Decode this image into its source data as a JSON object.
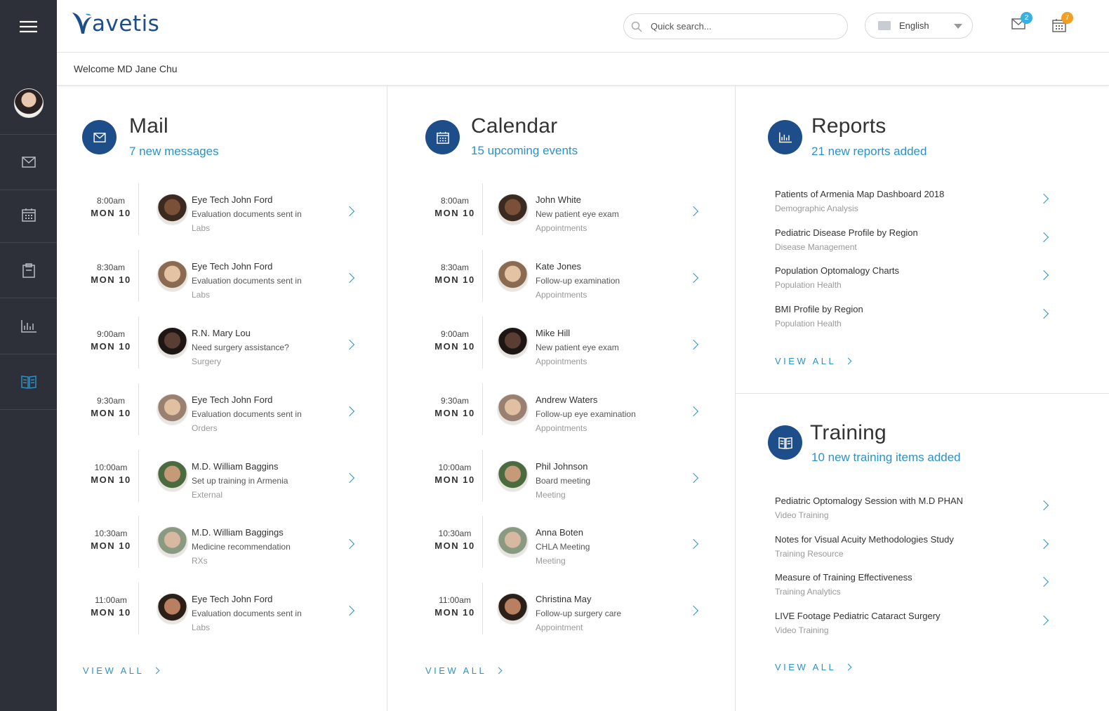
{
  "header": {
    "logo_text": "avetis",
    "search_placeholder": "Quick search...",
    "language": "English",
    "mail_badge": "2",
    "calendar_badge": "7",
    "mail_badge_color": "#3ab0e2",
    "calendar_badge_color": "#f0a024"
  },
  "welcome": "Welcome MD Jane Chu",
  "colors": {
    "accent": "#2a92c8",
    "brand": "#1d4e89",
    "sidebar": "#2d3038"
  },
  "mail": {
    "title": "Mail",
    "subtitle": "7 new messages",
    "view_all": "VIEW ALL",
    "items": [
      {
        "time": "8:00am",
        "day": "MON 10",
        "name": "Eye Tech John Ford",
        "desc": "Evaluation documents sent in",
        "cat": "Labs"
      },
      {
        "time": "8:30am",
        "day": "MON 10",
        "name": "Eye Tech John Ford",
        "desc": "Evaluation documents sent in",
        "cat": "Labs"
      },
      {
        "time": "9:00am",
        "day": "MON 10",
        "name": "R.N. Mary Lou",
        "desc": "Need surgery assistance?",
        "cat": "Surgery"
      },
      {
        "time": "9:30am",
        "day": "MON 10",
        "name": "Eye Tech John Ford",
        "desc": "Evaluation documents sent in",
        "cat": "Orders"
      },
      {
        "time": "10:00am",
        "day": "MON 10",
        "name": "M.D. William Baggins",
        "desc": "Set up training in Armenia",
        "cat": "External"
      },
      {
        "time": "10:30am",
        "day": "MON 10",
        "name": "M.D. William Baggings",
        "desc": "Medicine recommendation",
        "cat": "RXs"
      },
      {
        "time": "11:00am",
        "day": "MON 10",
        "name": "Eye Tech John Ford",
        "desc": "Evaluation documents sent in",
        "cat": "Labs"
      }
    ]
  },
  "calendar": {
    "title": "Calendar",
    "subtitle": "15 upcoming events",
    "view_all": "VIEW ALL",
    "items": [
      {
        "time": "8:00am",
        "day": "MON 10",
        "name": "John White",
        "desc": "New patient eye exam",
        "cat": "Appointments"
      },
      {
        "time": "8:30am",
        "day": "MON 10",
        "name": "Kate Jones",
        "desc": "Follow-up examination",
        "cat": "Appointments"
      },
      {
        "time": "9:00am",
        "day": "MON 10",
        "name": "Mike Hill",
        "desc": "New patient eye exam",
        "cat": "Appointments"
      },
      {
        "time": "9:30am",
        "day": "MON 10",
        "name": "Andrew Waters",
        "desc": "Follow-up eye examination",
        "cat": "Appointments"
      },
      {
        "time": "10:00am",
        "day": "MON 10",
        "name": "Phil Johnson",
        "desc": "Board meeting",
        "cat": "Meeting"
      },
      {
        "time": "10:30am",
        "day": "MON 10",
        "name": "Anna Boten",
        "desc": "CHLA Meeting",
        "cat": "Meeting"
      },
      {
        "time": "11:00am",
        "day": "MON 10",
        "name": "Christina May",
        "desc": "Follow-up surgery care",
        "cat": "Appointment"
      }
    ]
  },
  "reports": {
    "title": "Reports",
    "subtitle": "21 new reports added",
    "view_all": "VIEW ALL",
    "items": [
      {
        "title": "Patients of Armenia Map Dashboard 2018",
        "cat": "Demographic Analysis"
      },
      {
        "title": "Pediatric Disease Profile by Region",
        "cat": "Disease Management"
      },
      {
        "title": "Population Optomalogy Charts",
        "cat": "Population Health"
      },
      {
        "title": "BMI Profile by Region",
        "cat": "Population Health"
      }
    ]
  },
  "training": {
    "title": "Training",
    "subtitle": "10 new training items added",
    "view_all": "VIEW ALL",
    "items": [
      {
        "title": "Pediatric Optomalogy Session with M.D PHAN",
        "cat": "Video Training"
      },
      {
        "title": "Notes for Visual Acuity Methodologies Study",
        "cat": "Training Resource"
      },
      {
        "title": "Measure of Training Effectiveness",
        "cat": "Training Analytics"
      },
      {
        "title": "LIVE Footage Pediatric Cataract Surgery",
        "cat": "Video Training"
      }
    ]
  }
}
